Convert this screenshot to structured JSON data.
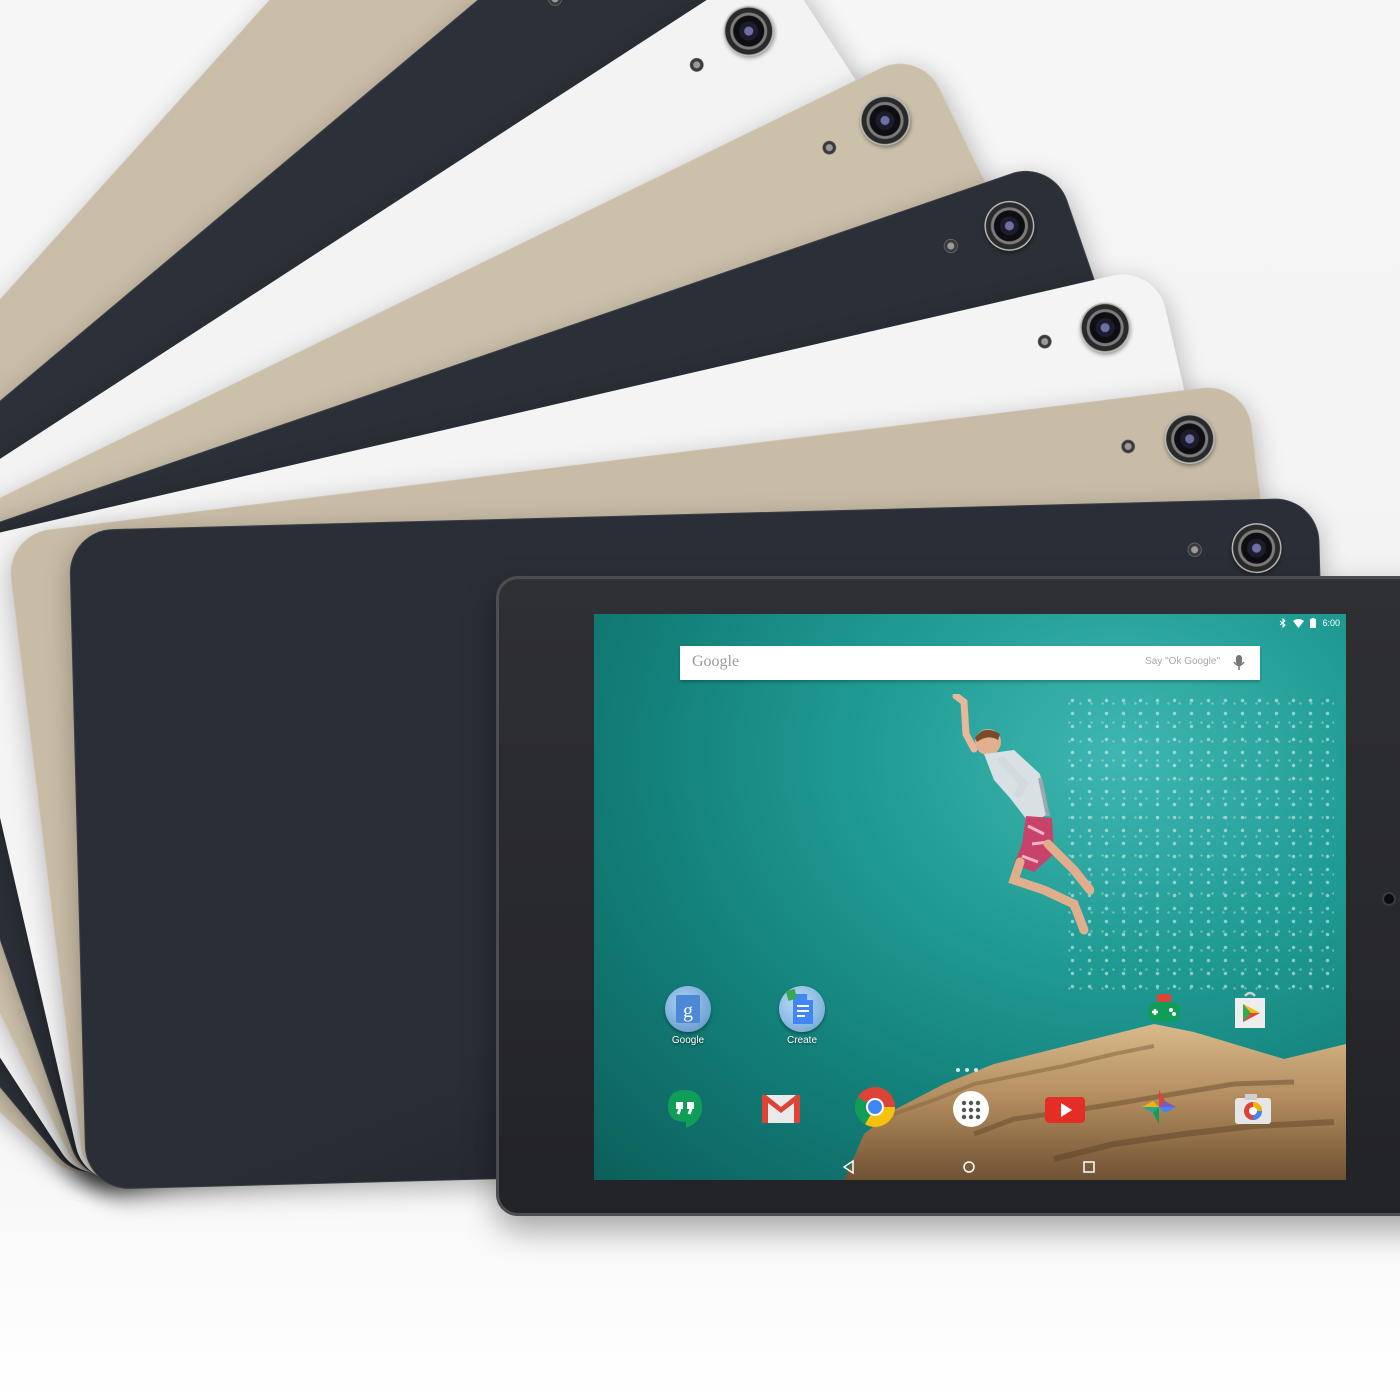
{
  "backs": [
    {
      "color": "#c9bda8",
      "edge": "#b3a78f"
    },
    {
      "color": "#2c3038",
      "edge": "#1d2026"
    },
    {
      "color": "#f3f3f3",
      "edge": "#dedede"
    },
    {
      "color": "#cbc0aa",
      "edge": "#b5a98f"
    },
    {
      "color": "#2b2f37",
      "edge": "#1c1f25"
    },
    {
      "color": "#f4f4f4",
      "edge": "#dfdfdf"
    },
    {
      "color": "#c8bca6",
      "edge": "#b2a68c"
    },
    {
      "color": "#2a2e36",
      "edge": "#1b1e24"
    }
  ],
  "status_bar": {
    "time": "6:00"
  },
  "search": {
    "logo": "Google",
    "hint": "Say \"Ok Google\""
  },
  "home_icons": [
    {
      "name": "google-folder",
      "label": "Google"
    },
    {
      "name": "create-folder",
      "label": "Create"
    },
    {
      "name": "play-games-icon",
      "label": ""
    },
    {
      "name": "play-store-icon",
      "label": ""
    }
  ],
  "dock": [
    "hangouts",
    "gmail",
    "chrome",
    "app-drawer",
    "youtube",
    "photos",
    "camera"
  ],
  "colors": {
    "accent_red": "#db4437",
    "accent_blue": "#4285f4",
    "accent_green": "#0f9d58",
    "accent_yellow": "#f4b400"
  }
}
